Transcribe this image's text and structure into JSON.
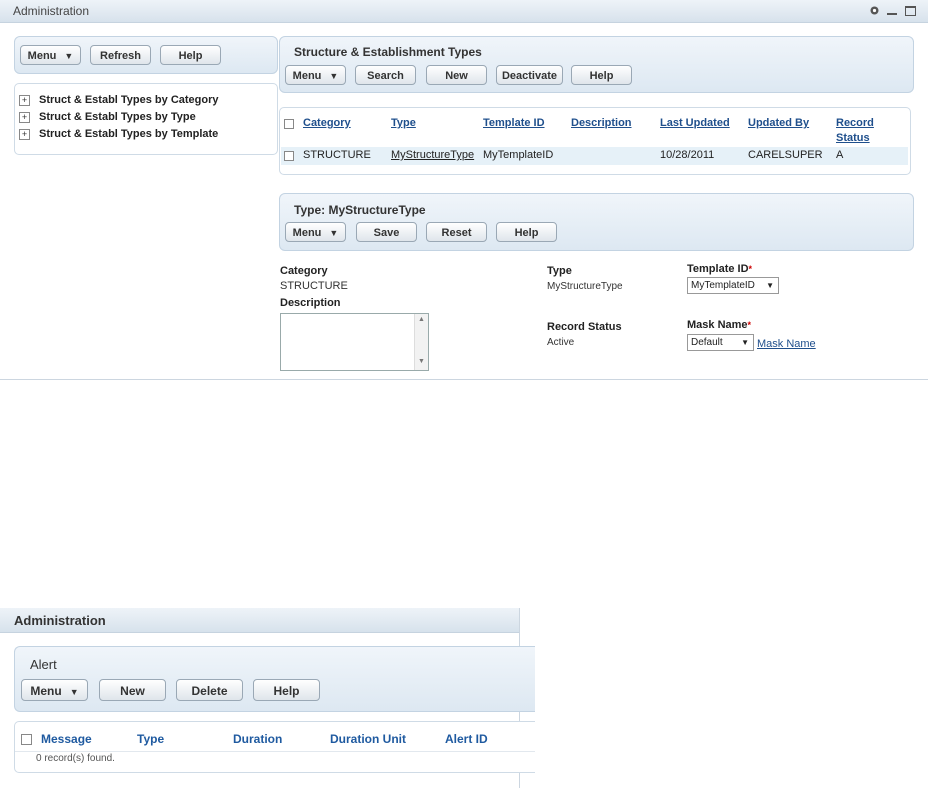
{
  "window1": {
    "title": "Administration",
    "controls": {
      "gear": "gear-icon",
      "minimize": "minimize-icon",
      "maximize": "maximize-icon"
    },
    "left_toolbar": {
      "menu": "Menu",
      "refresh": "Refresh",
      "help": "Help"
    },
    "tree": [
      {
        "label": "Struct & Establ Types by Category"
      },
      {
        "label": "Struct & Establ Types by Type"
      },
      {
        "label": "Struct & Establ Types by Template"
      }
    ],
    "list_panel": {
      "title": "Structure & Establishment Types",
      "buttons": {
        "menu": "Menu",
        "search": "Search",
        "new": "New",
        "deactivate": "Deactivate",
        "help": "Help"
      }
    },
    "table": {
      "headers": [
        "Category",
        "Type",
        "Template ID",
        "Description",
        "Last Updated",
        "Updated By",
        "Record",
        "Status"
      ],
      "rows": [
        {
          "category": "STRUCTURE",
          "type": "MyStructureType",
          "template_id": "MyTemplateID",
          "description": "",
          "last_updated": "10/28/2011",
          "updated_by": "CARELSUPER",
          "record_status": "A"
        }
      ]
    },
    "detail_panel": {
      "title": "Type: MyStructureType",
      "buttons": {
        "menu": "Menu",
        "save": "Save",
        "reset": "Reset",
        "help": "Help"
      }
    },
    "form": {
      "category_label": "Category",
      "category_value": "STRUCTURE",
      "description_label": "Description",
      "description_value": "",
      "type_label": "Type",
      "type_value": "MyStructureType",
      "record_status_label": "Record Status",
      "record_status_value": "Active",
      "template_id_label": "Template ID",
      "template_id_value": "MyTemplateID",
      "mask_name_label": "Mask Name",
      "mask_name_value": "Default",
      "mask_name_link": "Mask Name",
      "required_mark": "*"
    }
  },
  "window2": {
    "title": "Administration",
    "panel": {
      "title": "Alert",
      "buttons": {
        "menu": "Menu",
        "new": "New",
        "delete": "Delete",
        "help": "Help"
      }
    },
    "table": {
      "headers": [
        "Message",
        "Type",
        "Duration",
        "Duration Unit",
        "Alert ID"
      ],
      "empty_text": "0 record(s) found."
    }
  },
  "colors": {
    "accent": "#1f4f8c",
    "panel": "#dde8f2",
    "row_highlight": "#e6f1f8",
    "required": "#cc0000"
  }
}
